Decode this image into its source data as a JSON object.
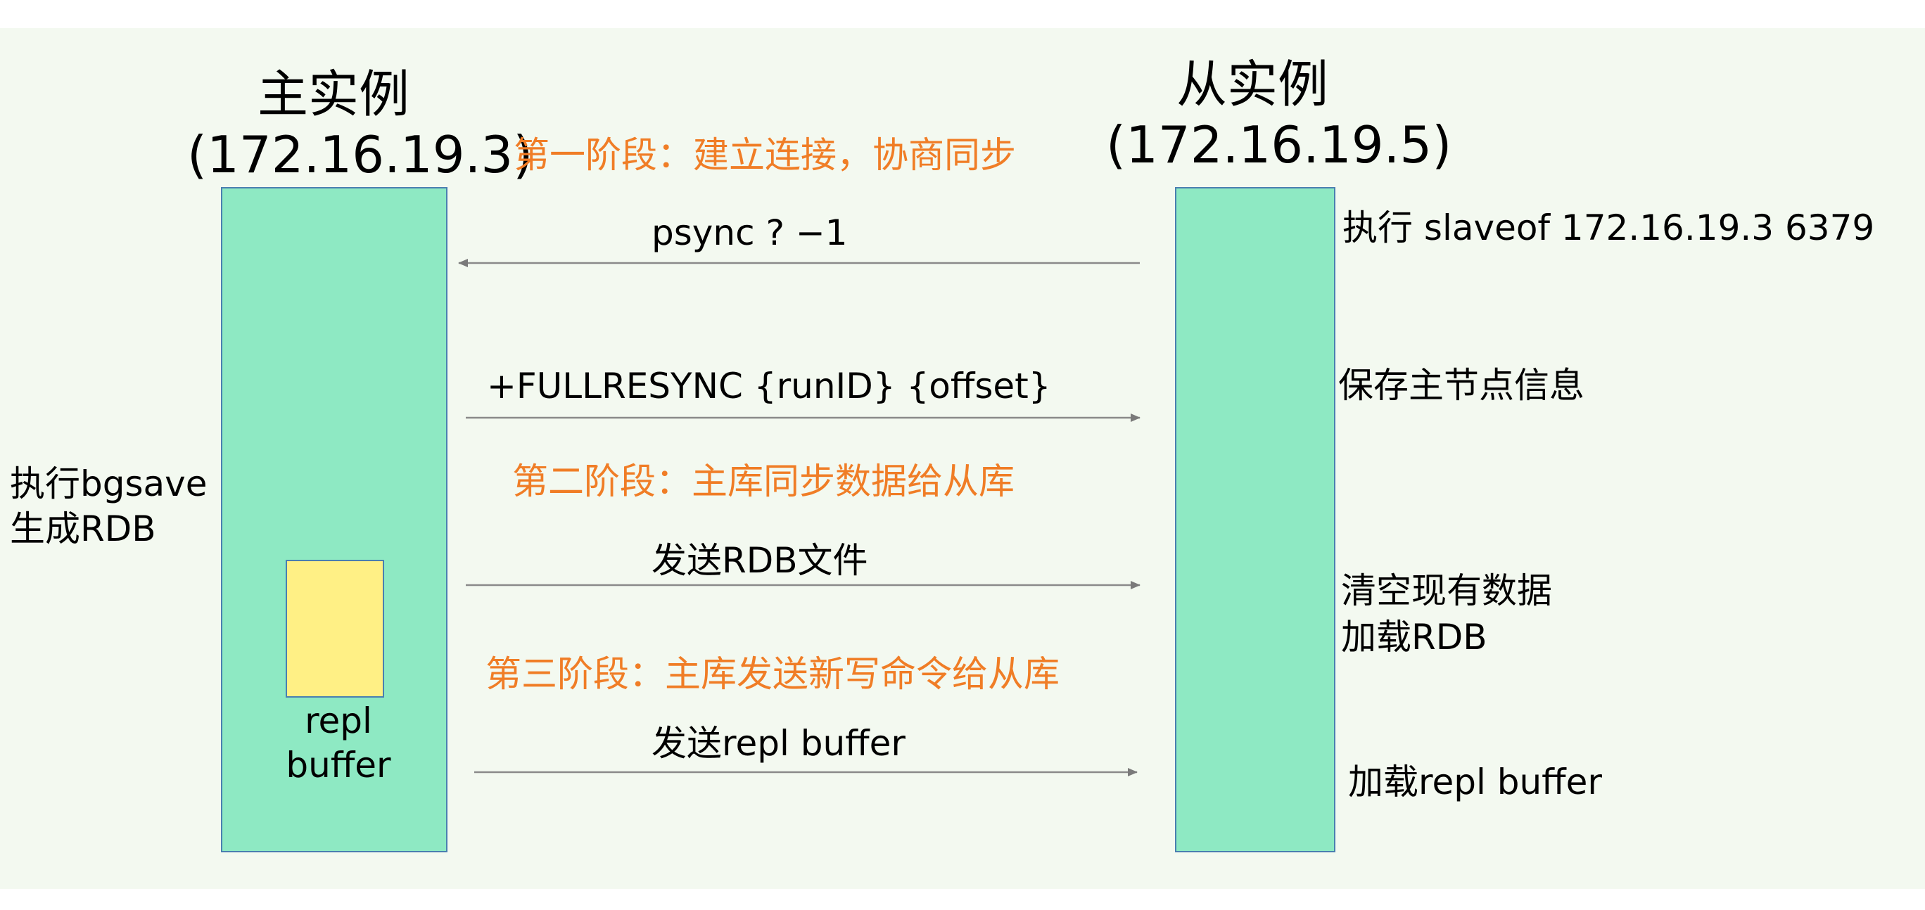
{
  "master": {
    "title": "主实例",
    "ip": "(172.16.19.3)",
    "buffer_label_1": "repl",
    "buffer_label_2": "buffer",
    "note_line_1": "执行bgsave",
    "note_line_2": "生成RDB"
  },
  "slave": {
    "title": "从实例",
    "ip": "(172.16.19.5)",
    "note_slaveof": "执行 slaveof  172.16.19.3  6379",
    "note_save": "保存主节点信息",
    "note_clear_1": "清空现有数据",
    "note_clear_2": "加载RDB",
    "note_load_buffer": "加载repl buffer"
  },
  "phases": {
    "phase1": "第一阶段：建立连接，协商同步",
    "phase2": "第二阶段：主库同步数据给从库",
    "phase3": "第三阶段：主库发送新写命令给从库"
  },
  "messages": {
    "psync": "psync ? −1",
    "fullresync": "+FULLRESYNC {runID} {offset}",
    "send_rdb": "发送RDB文件",
    "send_buffer": "发送repl buffer"
  },
  "colors": {
    "instance_fill": "#8ee9c3",
    "buffer_fill": "#fff085",
    "phase_text": "#f07d26",
    "arrow": "#808080",
    "background": "#f3f9f0"
  }
}
